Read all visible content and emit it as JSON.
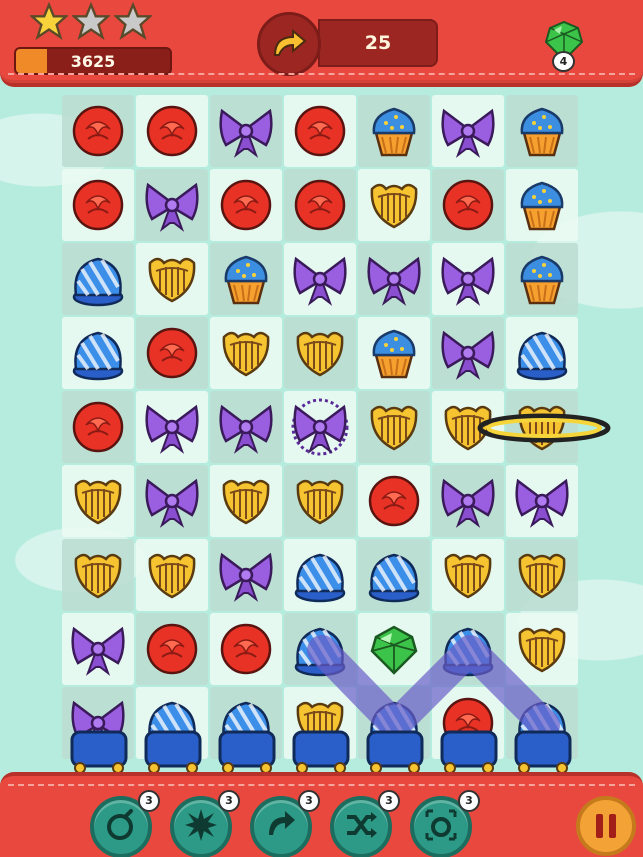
{
  "hud": {
    "stars_earned": 1,
    "stars_total": 3,
    "score": "3625",
    "score_progress": 0.2,
    "moves_left": "25",
    "gem_count": "4"
  },
  "board": {
    "rows": [
      [
        "rose",
        "rose",
        "bow",
        "rose",
        "cupcake",
        "bow",
        "cupcake"
      ],
      [
        "rose",
        "bow",
        "rose",
        "rose",
        "harp",
        "rose",
        "cupcake"
      ],
      [
        "hat",
        "harp",
        "cupcake",
        "bow",
        "bow",
        "bow",
        "cupcake"
      ],
      [
        "hat",
        "rose",
        "harp",
        "harp",
        "cupcake",
        "bow",
        "hat"
      ],
      [
        "rose",
        "bow",
        "bow",
        "bow-special",
        "harp",
        "harp",
        "harp-special"
      ],
      [
        "harp",
        "bow",
        "harp",
        "harp",
        "rose",
        "bow",
        "bow"
      ],
      [
        "harp",
        "harp",
        "bow",
        "hat",
        "hat",
        "harp",
        "harp"
      ],
      [
        "bow",
        "rose",
        "rose",
        "hat",
        "gem",
        "hat",
        "harp"
      ],
      [
        "bow",
        "hat",
        "hat",
        "harp",
        "hat",
        "rose",
        "hat"
      ]
    ]
  },
  "boosters": [
    {
      "name": "bomb-booster",
      "icon": "bomb-icon",
      "count": "3"
    },
    {
      "name": "star-booster",
      "icon": "star-burst-icon",
      "count": "3"
    },
    {
      "name": "extra-move-booster",
      "icon": "curved-arrow-icon",
      "count": "3"
    },
    {
      "name": "shuffle-booster",
      "icon": "shuffle-icon",
      "count": "3"
    },
    {
      "name": "target-bomb-booster",
      "icon": "target-bomb-icon",
      "count": "3"
    }
  ],
  "colors": {
    "bar_red": "#e8483e",
    "booster_teal": "#2c9a86",
    "pause_orange": "#f3a236"
  }
}
